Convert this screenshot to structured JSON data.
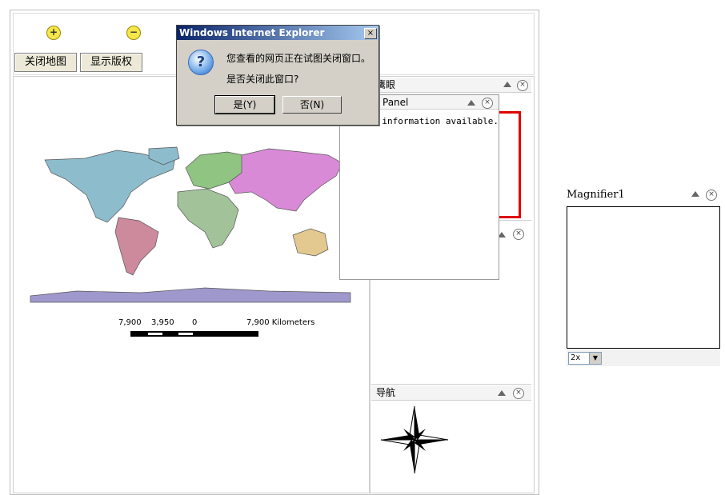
{
  "toolbar": {
    "close_map_label": "关闭地图",
    "show_copyright_label": "显示版权",
    "zoom_in_icon": "zoom-in-icon",
    "zoom_out_icon": "zoom-out-icon"
  },
  "map": {
    "scalebar_labels": [
      "7,900",
      "3,950",
      "0",
      "7,900 Kilometers"
    ]
  },
  "panels": {
    "overview_title": "鹰眼",
    "copyright_title": "Panel",
    "copyright_text": "yright information available.",
    "navigation_title": "导航"
  },
  "magnifier": {
    "title": "Magnifier1",
    "zoom_value": "2x"
  },
  "dialog": {
    "title": "Windows Internet Explorer",
    "message_line1": "您查看的网页正在试图关闭窗口。",
    "message_line2": "是否关闭此窗口?",
    "yes_label": "是(Y)",
    "no_label": "否(N)"
  },
  "colors": {
    "north_america": "#8dbccd",
    "south_america": "#cc8a9c",
    "europe": "#8fc483",
    "africa": "#a2c29a",
    "asia": "#d98ad6",
    "australia": "#e3c98f",
    "antarctica": "#9f98cc",
    "overview_border": "#e00000"
  }
}
